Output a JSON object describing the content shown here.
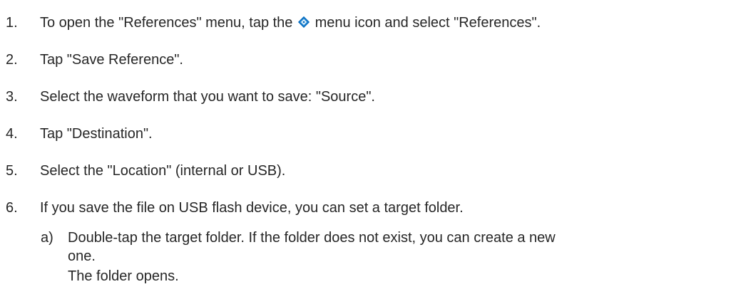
{
  "steps": [
    {
      "num": "1.",
      "before": "To open the \"References\" menu, tap the",
      "after": "menu icon and select \"References\".",
      "icon": "menu-diamond-icon"
    },
    {
      "num": "2.",
      "text": "Tap \"Save Reference\"."
    },
    {
      "num": "3.",
      "text": "Select the waveform that you want to save: \"Source\"."
    },
    {
      "num": "4.",
      "text": "Tap \"Destination\"."
    },
    {
      "num": "5.",
      "text": "Select the \"Location\" (internal or USB)."
    },
    {
      "num": "6.",
      "text": "If you save the file on USB flash device, you can set a target folder."
    }
  ],
  "substep": {
    "num": "a)",
    "line1": "Double-tap the target folder. If the folder does not exist, you can create a new",
    "line2": "one.",
    "result": "The folder opens."
  },
  "colors": {
    "text": "#262626",
    "icon_blue": "#0a6fc2",
    "icon_light": "#7cc3f2"
  }
}
